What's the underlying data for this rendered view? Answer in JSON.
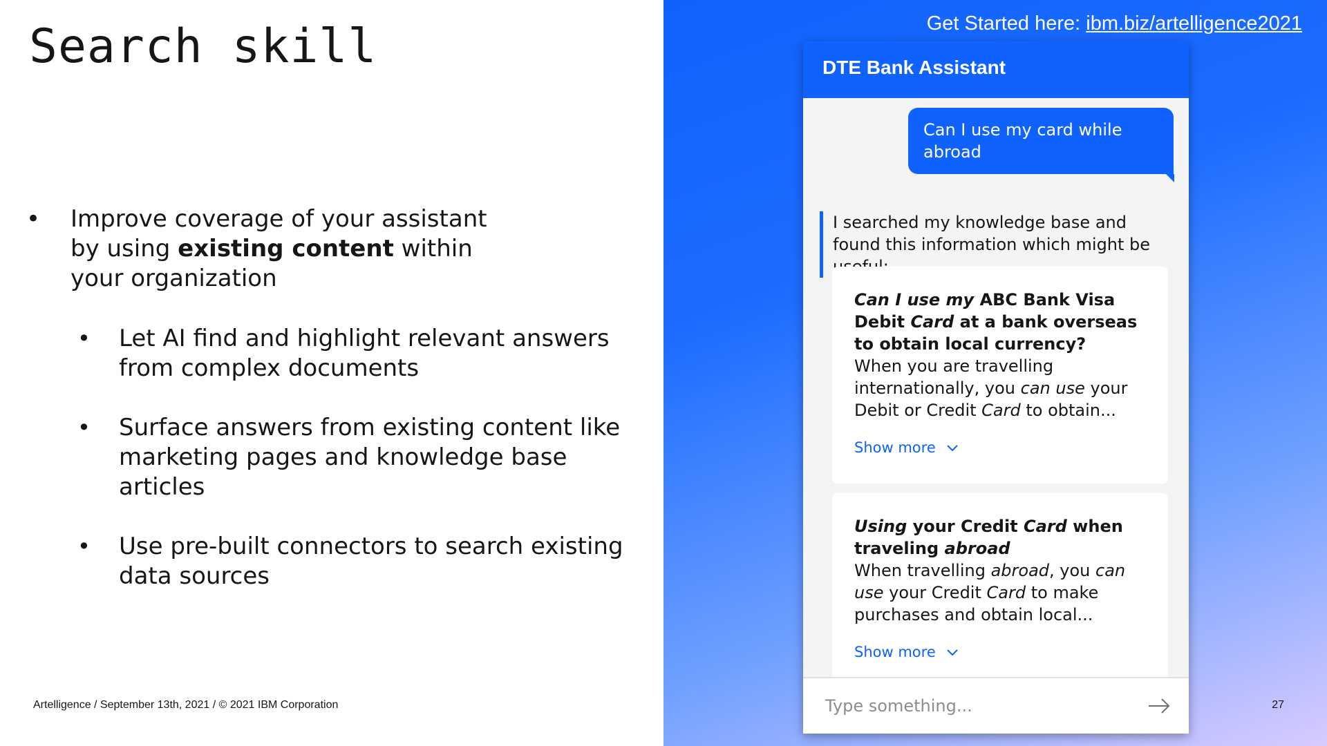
{
  "slide": {
    "title": "Search skill",
    "main_bullet": {
      "text_before": "Improve coverage of your assistant by using ",
      "bold": "existing content",
      "text_after": " within your organization"
    },
    "sub_bullets": [
      "Let AI find and highlight relevant answers from complex documents",
      "Surface answers from existing content like marketing pages and knowledge base articles",
      "Use pre-built connectors to search existing data sources"
    ],
    "footer": "Artelligence / September 13th, 2021 / © 2021 IBM Corporation",
    "page_number": "27"
  },
  "banner": {
    "label": "Get Started here: ",
    "link_text": "ibm.biz/artelligence2021"
  },
  "chat": {
    "header_title": "DTE Bank Assistant",
    "user_message": "Can I use my card while abroad",
    "bot_intro": "I searched my knowledge base and found this information which might be useful:",
    "results": [
      {
        "title_parts": [
          {
            "text": "Can I use my",
            "italic": true
          },
          {
            "text": " ABC Bank Visa Debit ",
            "italic": false
          },
          {
            "text": "Card",
            "italic": true
          },
          {
            "text": " at a bank overseas to obtain local currency?",
            "italic": false
          }
        ],
        "body_parts": [
          {
            "text": "When you are travelling internationally, you ",
            "italic": false
          },
          {
            "text": "can use",
            "italic": true
          },
          {
            "text": " your Debit or Credit ",
            "italic": false
          },
          {
            "text": "Card",
            "italic": true
          },
          {
            "text": " to obtain...",
            "italic": false
          }
        ],
        "show_more": "Show more"
      },
      {
        "title_parts": [
          {
            "text": "Using",
            "italic": true
          },
          {
            "text": " your Credit ",
            "italic": false
          },
          {
            "text": "Card",
            "italic": true
          },
          {
            "text": " when traveling ",
            "italic": false
          },
          {
            "text": "abroad",
            "italic": true
          }
        ],
        "body_parts": [
          {
            "text": "When travelling ",
            "italic": false
          },
          {
            "text": "abroad",
            "italic": true
          },
          {
            "text": ", you ",
            "italic": false
          },
          {
            "text": "can use",
            "italic": true
          },
          {
            "text": " your Credit ",
            "italic": false
          },
          {
            "text": "Card",
            "italic": true
          },
          {
            "text": " to make purchases and obtain local...",
            "italic": false
          }
        ],
        "show_more": "Show more"
      }
    ],
    "input_placeholder": "Type something...",
    "send_icon": "arrow-right-icon",
    "show_more_icon": "chevron-down-icon"
  },
  "colors": {
    "accent": "#0f62fe",
    "chat_background": "#f4f4f4",
    "card_background": "#ffffff",
    "text": "#161616",
    "placeholder": "#8d8d8d",
    "gradient_end": "#d8cbff"
  }
}
